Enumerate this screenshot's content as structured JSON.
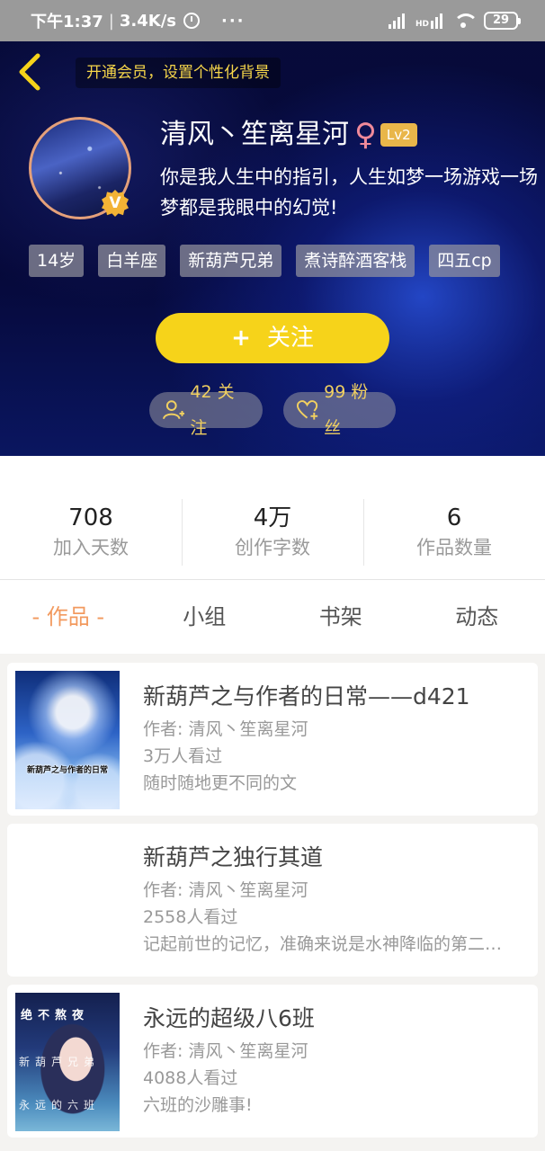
{
  "status_bar": {
    "time": "下午1:37",
    "speed": "3.4K/s",
    "dots": "···",
    "battery": "29"
  },
  "header": {
    "vip_banner": "开通会员，设置个性化背景",
    "username": "清风丶笙离星河",
    "gender_symbol": "♀",
    "level": "Lv2",
    "verified_badge": "V",
    "bio": "你是我人生中的指引，人生如梦一场游戏一场梦都是我眼中的幻觉!",
    "tags": [
      "14岁",
      "白羊座",
      "新葫芦兄弟",
      "煮诗醉酒客栈",
      "四五cp"
    ],
    "follow_button": "关注",
    "follow_plus": "+",
    "following_label": "42 关注",
    "fans_label": "99 粉丝",
    "accent_color": "#f6d31a"
  },
  "stats": [
    {
      "value": "708",
      "label": "加入天数"
    },
    {
      "value": "4万",
      "label": "创作字数"
    },
    {
      "value": "6",
      "label": "作品数量"
    }
  ],
  "tabs": [
    {
      "label": "- 作品 -",
      "active": true
    },
    {
      "label": "小组",
      "active": false
    },
    {
      "label": "书架",
      "active": false
    },
    {
      "label": "动态",
      "active": false
    }
  ],
  "works": [
    {
      "title": "新葫芦之与作者的日常——d421",
      "author": "作者: 清风丶笙离星河",
      "views": "3万人看过",
      "desc": "随时随地更不同的文",
      "cover_text": "新葫芦之与作者的日常"
    },
    {
      "title": "新葫芦之独行其道",
      "author": "作者: 清风丶笙离星河",
      "views": "2558人看过",
      "desc": "记起前世的记忆，准确来说是水神降临的第二…"
    },
    {
      "title": "永远的超级八6班",
      "author": "作者: 清风丶笙离星河",
      "views": "4088人看过",
      "desc": "六班的沙雕事!",
      "cover_top": "绝不熬夜",
      "cover_mid": "新葫芦兄弟",
      "cover_bot": "永远的六班"
    }
  ]
}
